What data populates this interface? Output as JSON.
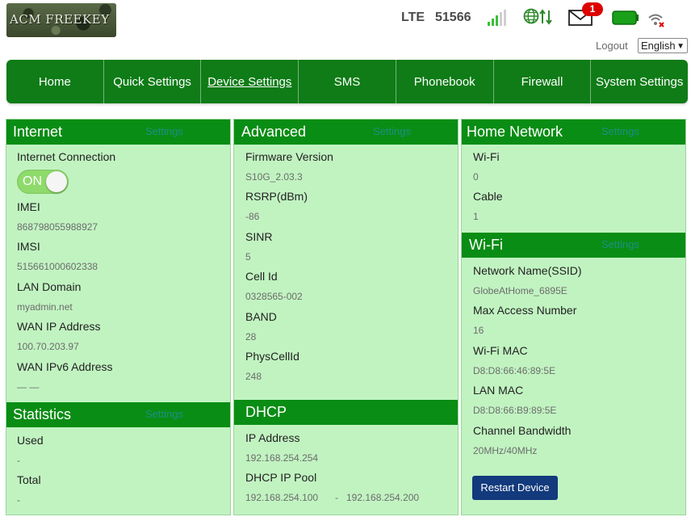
{
  "header": {
    "logo_text": "ACM FREEKEY",
    "network_type": "LTE",
    "network_id": "51566",
    "sms_unread_count": "1",
    "logout_label": "Logout",
    "language": "English",
    "icons": [
      "signal-icon",
      "globe-data-icon",
      "mail-icon",
      "battery-icon",
      "wifi-disabled-icon"
    ]
  },
  "nav": {
    "items": [
      "Home",
      "Quick Settings",
      "Device Settings",
      "SMS",
      "Phonebook",
      "Firewall",
      "System Settings"
    ],
    "active": "Device Settings"
  },
  "internet": {
    "title": "Internet",
    "settings_link": "Settings",
    "connection_label": "Internet Connection",
    "toggle_label": "ON",
    "fields": [
      {
        "label": "IMEI",
        "value": "868798055988927"
      },
      {
        "label": "IMSI",
        "value": "515661000602338"
      },
      {
        "label": "LAN Domain",
        "value": "myadmin.net"
      },
      {
        "label": "WAN IP Address",
        "value": "100.70.203.97"
      },
      {
        "label": "WAN IPv6 Address",
        "value": "— —"
      }
    ]
  },
  "statistics": {
    "title": "Statistics",
    "settings_link": "Settings",
    "fields": [
      {
        "label": "Used",
        "value": "-"
      },
      {
        "label": "Total",
        "value": "-"
      }
    ]
  },
  "advanced": {
    "title": "Advanced",
    "settings_link": "Settings",
    "fields": [
      {
        "label": "Firmware Version",
        "value": "S10G_2.03.3"
      },
      {
        "label": "RSRP(dBm)",
        "value": "-86"
      },
      {
        "label": "SINR",
        "value": "5"
      },
      {
        "label": "Cell Id",
        "value": "0328565-002"
      },
      {
        "label": "BAND",
        "value": "28"
      },
      {
        "label": "PhysCellId",
        "value": "248"
      }
    ]
  },
  "dhcp": {
    "title": "DHCP",
    "ip_label": "IP Address",
    "ip_value": "192.168.254.254",
    "pool_label": "DHCP IP Pool",
    "pool_start": "192.168.254.100",
    "pool_sep": "-",
    "pool_end": "192.168.254.200"
  },
  "home_network": {
    "title": "Home Network",
    "settings_link": "Settings",
    "fields": [
      {
        "label": "Wi-Fi",
        "value": "0"
      },
      {
        "label": "Cable",
        "value": "1"
      }
    ]
  },
  "wifi": {
    "title": "Wi-Fi",
    "settings_link": "Settings",
    "fields": [
      {
        "label": "Network Name(SSID)",
        "value": "GlobeAtHome_6895E"
      },
      {
        "label": "Max Access Number",
        "value": "16"
      },
      {
        "label": "Wi-Fi MAC",
        "value": "D8:D8:66:46:89:5E"
      },
      {
        "label": "LAN MAC",
        "value": "D8:D8:66:B9:89:5E"
      },
      {
        "label": "Channel Bandwidth",
        "value": "20MHz/40MHz"
      }
    ],
    "restart_label": "Restart Device"
  },
  "colors": {
    "nav_green": "#0f7c17",
    "panel_header_green": "#0a8d14",
    "panel_bg": "#c1f3c1",
    "button_blue": "#123a7c",
    "badge_red": "#dd0000"
  }
}
